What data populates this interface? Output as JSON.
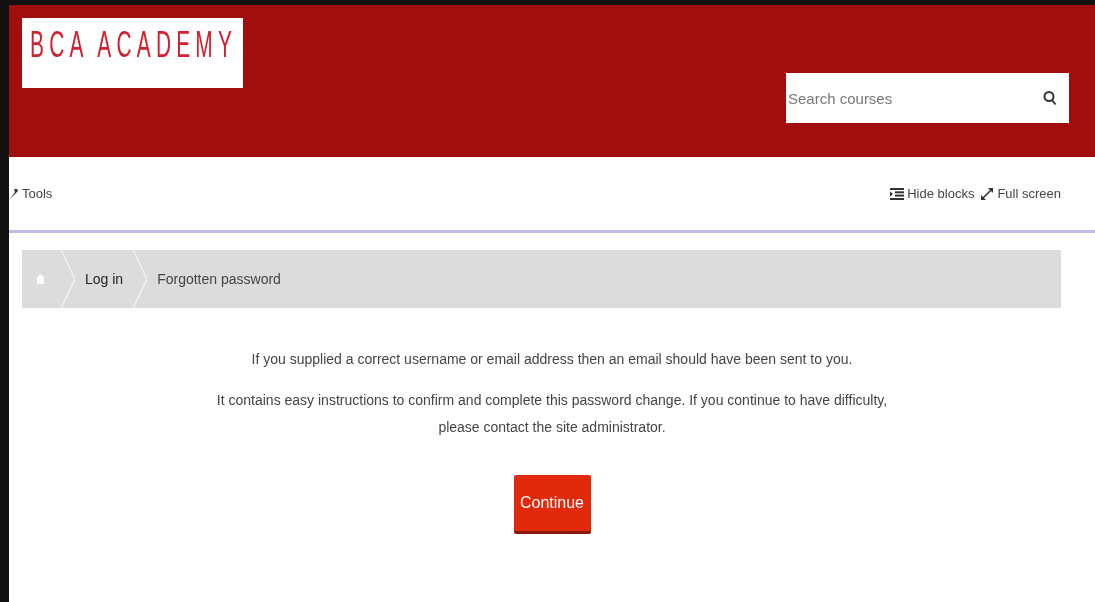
{
  "header": {
    "logo": "BCA ACADEMY",
    "search": {
      "placeholder": "Search courses"
    }
  },
  "navbar": {
    "tools": "Tools",
    "hide_blocks": "Hide blocks",
    "full_screen": "Full screen"
  },
  "breadcrumb": [
    {
      "label": "Log in"
    },
    {
      "label": "Forgotten password"
    }
  ],
  "notice": {
    "paragraphs": [
      "If you supplied a correct username or email address then an email should have been sent to you.",
      "It contains easy instructions to confirm and complete this password change. If you continue to have difficulty, please contact the site administrator."
    ],
    "button": "Continue"
  }
}
